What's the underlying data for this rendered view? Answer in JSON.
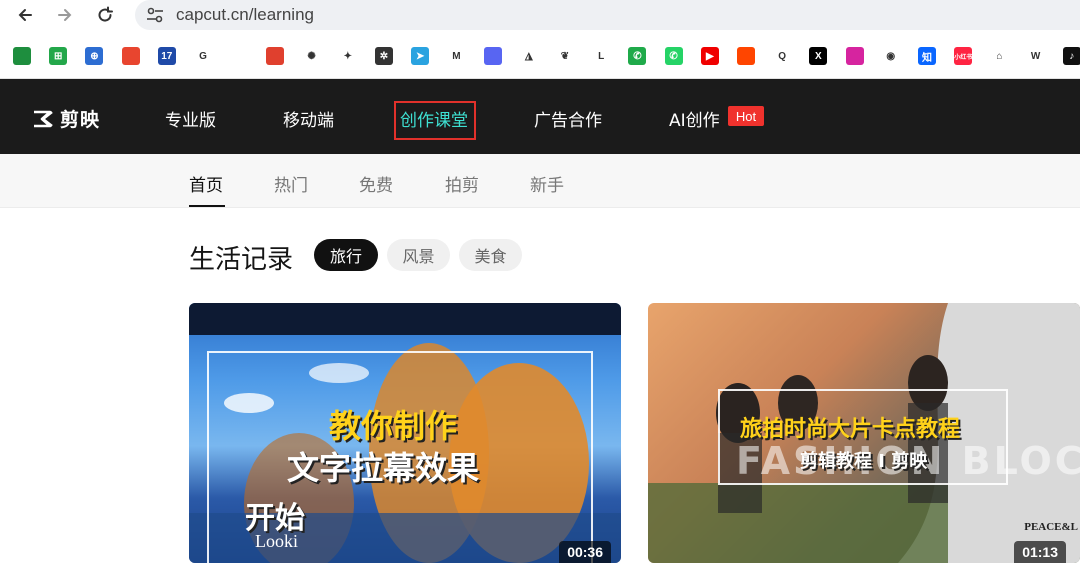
{
  "browser": {
    "url": "capcut.cn/learning",
    "bookmarks": [
      {
        "icon": "sheets-icon",
        "color": "#1e8e3e",
        "glyph": ""
      },
      {
        "icon": "grid-calc-icon",
        "color": "#23a74a",
        "glyph": "⊞"
      },
      {
        "icon": "globe-icon",
        "color": "#2d6dd2",
        "glyph": "⊕"
      },
      {
        "icon": "weibo-red-icon",
        "color": "#e8452f",
        "glyph": ""
      },
      {
        "icon": "number-17-icon",
        "color": "#1f4aa8",
        "glyph": "17"
      },
      {
        "icon": "google-icon",
        "color": "#ffffff",
        "glyph": "G"
      },
      {
        "icon": "maps-pin-icon",
        "color": "#ffffff",
        "glyph": ""
      },
      {
        "icon": "maps-red-icon",
        "color": "#e0402e",
        "glyph": ""
      },
      {
        "icon": "openai-icon",
        "color": "#ffffff",
        "glyph": "✺"
      },
      {
        "icon": "gemini-icon",
        "color": "#ffffff",
        "glyph": "✦"
      },
      {
        "icon": "dark-square-icon",
        "color": "#333333",
        "glyph": "✲"
      },
      {
        "icon": "telegram-icon",
        "color": "#2aa3e0",
        "glyph": "➤"
      },
      {
        "icon": "gmail-icon",
        "color": "#ffffff",
        "glyph": "M"
      },
      {
        "icon": "discord-icon",
        "color": "#5865f2",
        "glyph": ""
      },
      {
        "icon": "triangle-icon",
        "color": "#ffffff",
        "glyph": "◮"
      },
      {
        "icon": "leaf-icon",
        "color": "#ffffff",
        "glyph": "❦"
      },
      {
        "icon": "letter-l-icon",
        "color": "#ffffff",
        "glyph": "L"
      },
      {
        "icon": "phone-icon",
        "color": "#1faa4a",
        "glyph": "✆"
      },
      {
        "icon": "whatsapp-icon",
        "color": "#25d366",
        "glyph": "✆"
      },
      {
        "icon": "youtube-icon",
        "color": "#f00000",
        "glyph": "▶"
      },
      {
        "icon": "reddit-icon",
        "color": "#ff4500",
        "glyph": ""
      },
      {
        "icon": "quora-icon",
        "color": "#ffffff",
        "glyph": "Q"
      },
      {
        "icon": "x-icon",
        "color": "#000000",
        "glyph": "X"
      },
      {
        "icon": "instagram-icon",
        "color": "#d6249f",
        "glyph": ""
      },
      {
        "icon": "weibo-icon",
        "color": "#ffffff",
        "glyph": "◉"
      },
      {
        "icon": "zhihu-icon",
        "color": "#0a66ff",
        "glyph": "知"
      },
      {
        "icon": "xiaohongshu-icon",
        "color": "#ff2442",
        "glyph": "小红书"
      },
      {
        "icon": "bilibili-icon",
        "color": "#ffffff",
        "glyph": "⌂"
      },
      {
        "icon": "w-icon",
        "color": "#ffffff",
        "glyph": "W"
      },
      {
        "icon": "tiktok-icon",
        "color": "#111111",
        "glyph": "♪"
      }
    ]
  },
  "site": {
    "logo_text": "剪映",
    "nav": [
      {
        "label": "专业版"
      },
      {
        "label": "移动端"
      },
      {
        "label": "创作课堂"
      },
      {
        "label": "广告合作"
      },
      {
        "label": "AI创作"
      }
    ],
    "hot_badge": "Hot",
    "sub_nav": [
      "首页",
      "热门",
      "免费",
      "拍剪",
      "新手"
    ],
    "section": {
      "title": "生活记录",
      "chips": [
        "旅行",
        "风景",
        "美食"
      ]
    },
    "cards": [
      {
        "line1": "教你制作",
        "line2": "文字拉幕效果",
        "overlay_a": "开始",
        "overlay_b": "Looki",
        "duration": "00:36"
      },
      {
        "line1": "旅拍时尚大片卡点教程",
        "line2": "剪辑教程 I 剪映",
        "bg_text": "FASHION BLOCKBUS",
        "corner_text": "PEACE&L",
        "duration": "01:13"
      }
    ]
  }
}
